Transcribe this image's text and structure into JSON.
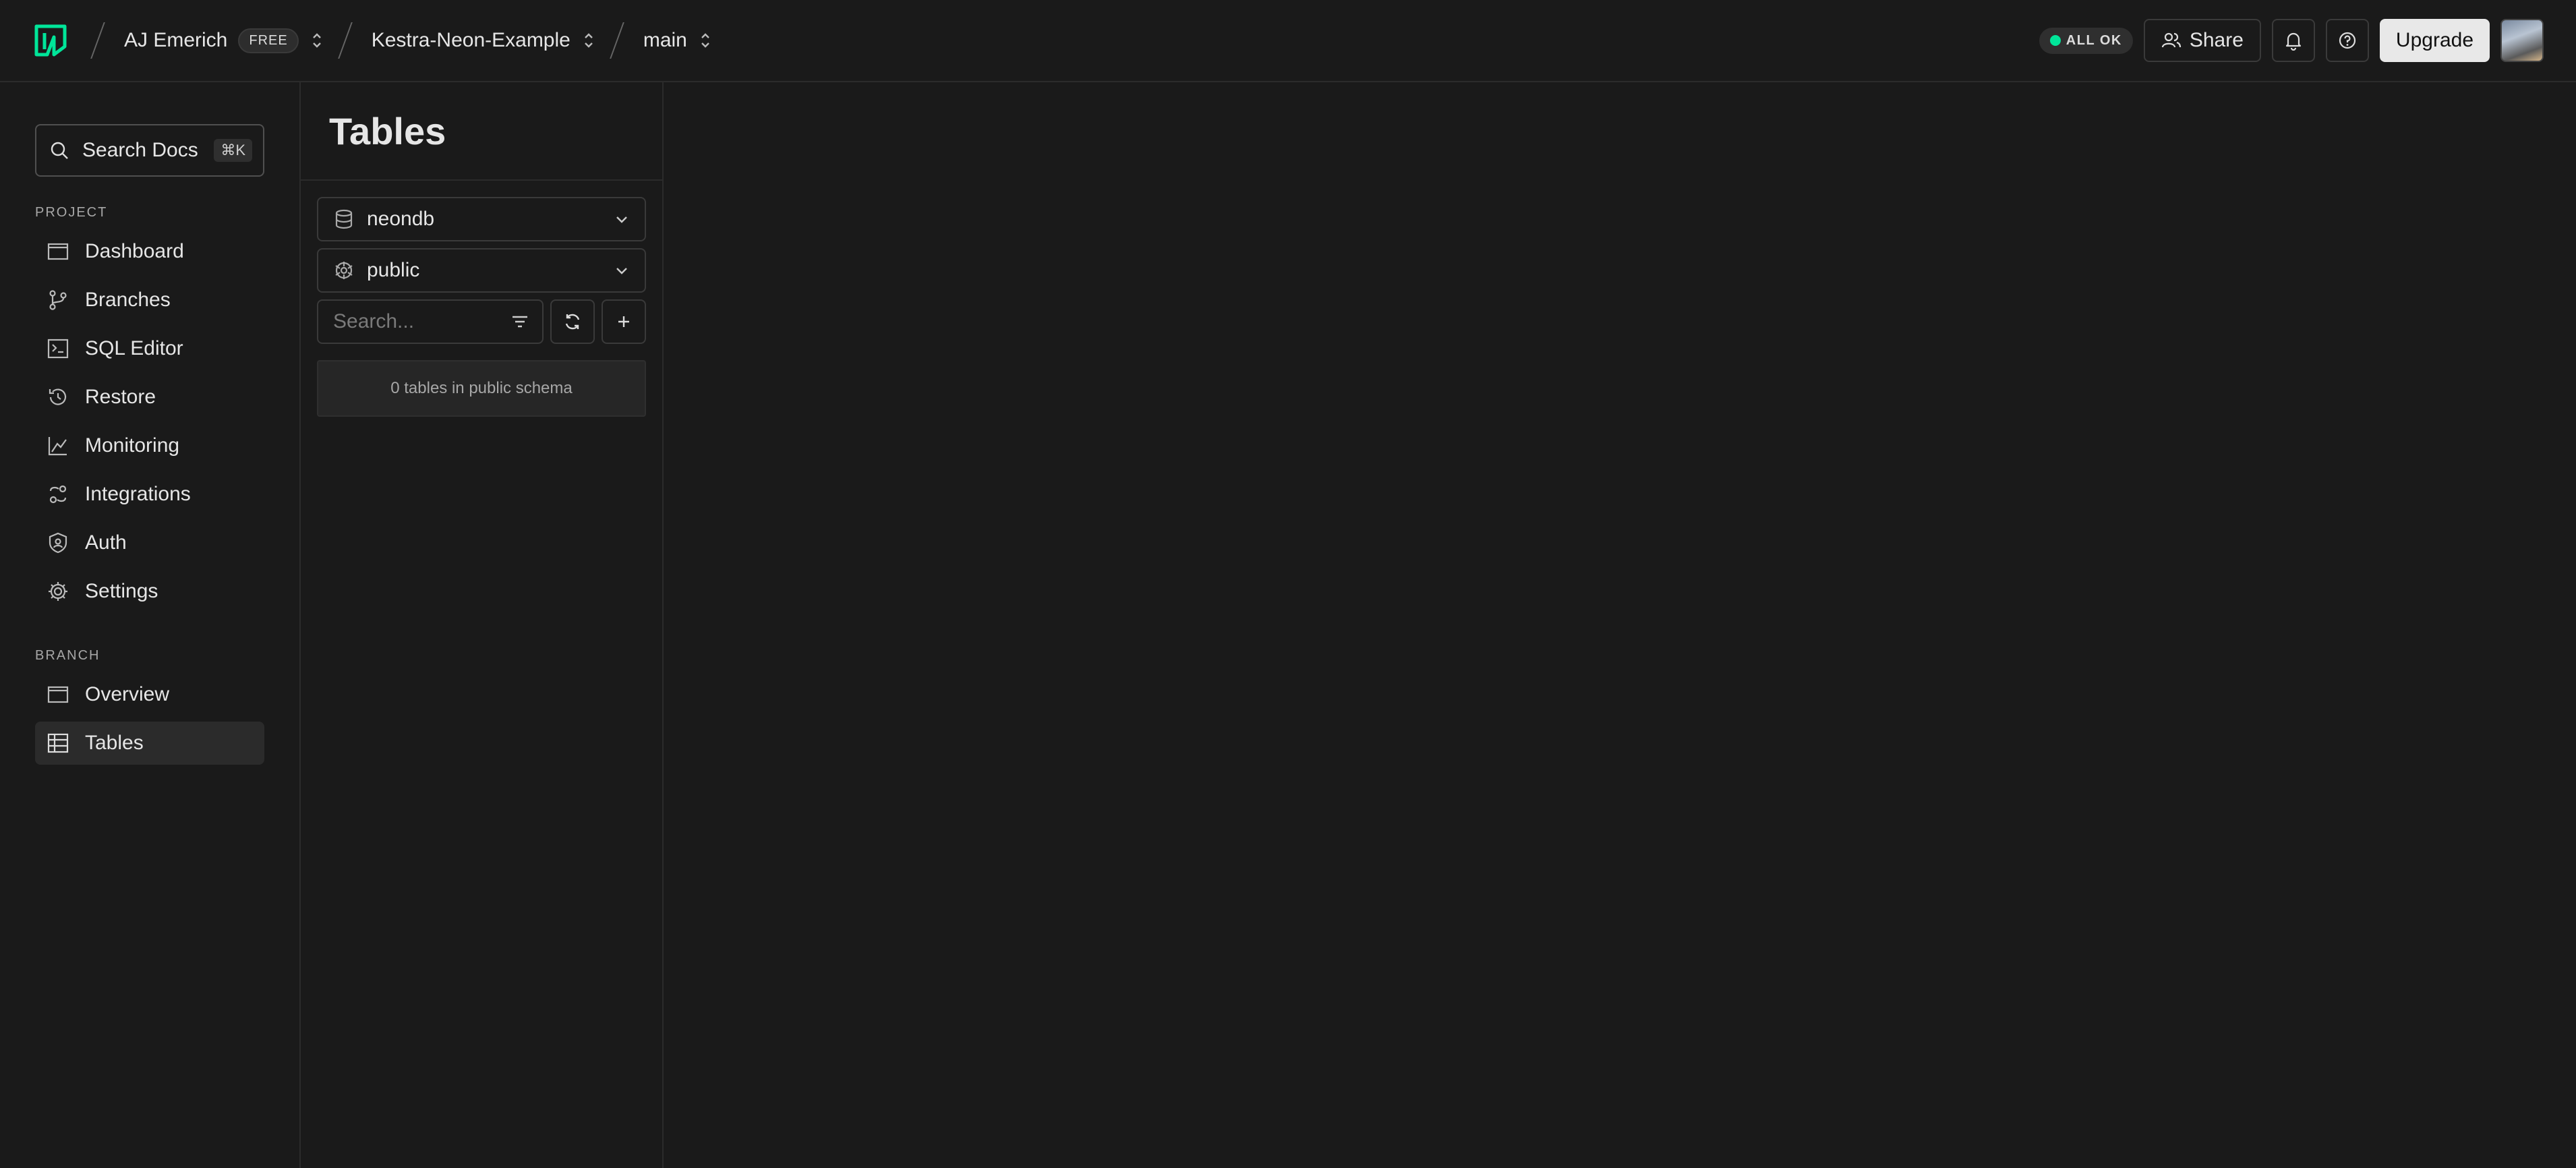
{
  "header": {
    "logo_icon": "neon-logo-icon",
    "org_name": "AJ Emerich",
    "plan_badge": "FREE",
    "project_name": "Kestra-Neon-Example",
    "branch_name": "main",
    "status_text": "ALL OK",
    "share_label": "Share",
    "upgrade_label": "Upgrade",
    "status_color": "#00e599"
  },
  "sidebar": {
    "search_label": "Search Docs",
    "search_shortcut": "⌘K",
    "project_section": "PROJECT",
    "project_items": [
      {
        "label": "Dashboard",
        "icon": "dashboard-icon"
      },
      {
        "label": "Branches",
        "icon": "branches-icon"
      },
      {
        "label": "SQL Editor",
        "icon": "sql-editor-icon"
      },
      {
        "label": "Restore",
        "icon": "restore-icon"
      },
      {
        "label": "Monitoring",
        "icon": "monitoring-icon"
      },
      {
        "label": "Integrations",
        "icon": "integrations-icon"
      },
      {
        "label": "Auth",
        "icon": "auth-icon"
      },
      {
        "label": "Settings",
        "icon": "settings-icon"
      }
    ],
    "branch_section": "BRANCH",
    "branch_items": [
      {
        "label": "Overview",
        "icon": "overview-icon"
      },
      {
        "label": "Tables",
        "icon": "tables-icon",
        "active": true
      }
    ]
  },
  "tables": {
    "title": "Tables",
    "database": "neondb",
    "schema": "public",
    "search_placeholder": "Search...",
    "empty_message": "0 tables in public schema"
  }
}
